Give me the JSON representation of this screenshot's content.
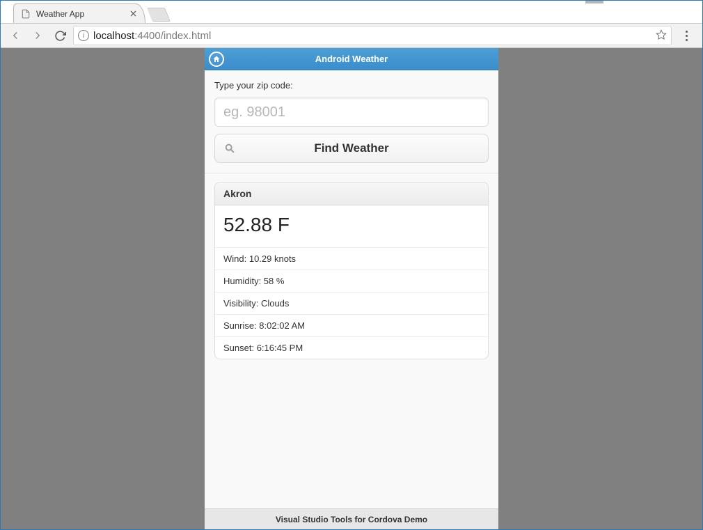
{
  "window": {
    "tab_title": "Weather App"
  },
  "address": {
    "host": "localhost",
    "port": ":4400",
    "path": "/index.html"
  },
  "app": {
    "header_title": "Android Weather",
    "form": {
      "label": "Type your zip code:",
      "placeholder": "eg. 98001",
      "button_label": "Find Weather"
    },
    "result": {
      "city": "Akron",
      "temperature": "52.88 F",
      "rows": {
        "wind": "Wind: 10.29 knots",
        "humidity": "Humidity: 58 %",
        "visibility": "Visibility: Clouds",
        "sunrise": "Sunrise: 8:02:02 AM",
        "sunset": "Sunset: 6:16:45 PM"
      }
    },
    "footer": "Visual Studio Tools for Cordova Demo"
  }
}
